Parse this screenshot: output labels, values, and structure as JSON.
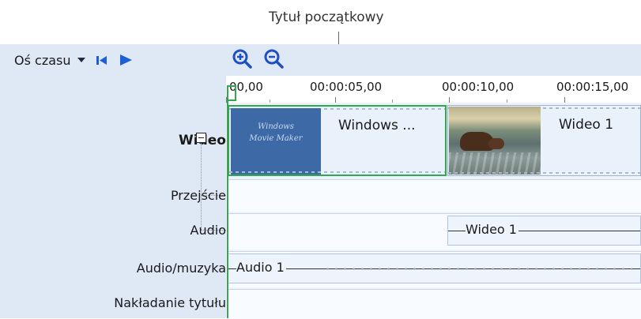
{
  "callout": {
    "label": "Tytuł początkowy"
  },
  "toolbar": {
    "timeline_label": "Oś czasu"
  },
  "ruler": {
    "ticks": [
      "00,00",
      "00:00:05,00",
      "00:00:10,00",
      "00:00:15,00"
    ]
  },
  "tracks": {
    "video": "Wideo",
    "transition": "Przejście",
    "audio": "Audio",
    "music": "Audio/muzyka",
    "title_overlay": "Nakładanie tytułu"
  },
  "clips": {
    "title_clip": {
      "thumb_line1": "Windows",
      "thumb_line2": "Movie Maker",
      "label": "Windows ..."
    },
    "video_clip": {
      "label": "Wideo 1"
    },
    "audio_clip": {
      "label": "Wideo 1"
    },
    "music_clip": {
      "label": "Audio 1"
    }
  },
  "colors": {
    "accent_green": "#2fa84f",
    "panel_blue": "#dfe8f5",
    "play_blue": "#1f5fd6"
  }
}
